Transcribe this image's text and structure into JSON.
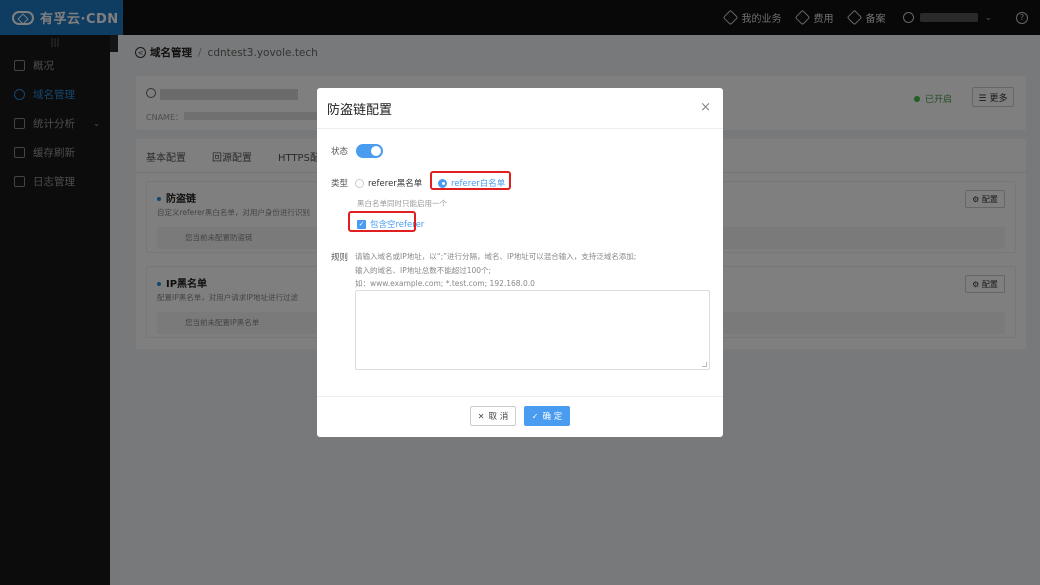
{
  "app": {
    "brand": "有孚云·CDN"
  },
  "topnav": {
    "items": [
      "我的业务",
      "费用",
      "备案"
    ]
  },
  "sidebar": {
    "collapse": "|||",
    "items": [
      {
        "label": "概况",
        "icon": "cube-icon"
      },
      {
        "label": "域名管理",
        "icon": "globe-icon",
        "active": true
      },
      {
        "label": "统计分析",
        "icon": "chart-icon",
        "expandable": true
      },
      {
        "label": "缓存刷新",
        "icon": "refresh-icon"
      },
      {
        "label": "日志管理",
        "icon": "file-icon"
      }
    ]
  },
  "breadcrumb": {
    "main": "域名管理",
    "sep": "/",
    "sub": "cdntest3.yovole.tech"
  },
  "domain_card": {
    "cname_label": "CNAME：",
    "status": "已开启",
    "more": "☰ 更多"
  },
  "tabs": [
    "基本配置",
    "回源配置",
    "HTTPS配置"
  ],
  "sections": [
    {
      "title": "防盗链",
      "desc": "自定义referer黑白名单，对用户身份进行识别",
      "empty": "您当前未配置防盗链",
      "btn": "⚙ 配置"
    },
    {
      "title": "IP黑名单",
      "desc": "配置IP黑名单，对用户请求IP地址进行过滤",
      "empty": "您当前未配置IP黑名单",
      "btn": "⚙ 配置"
    }
  ],
  "modal": {
    "title": "防盗链配置",
    "close": "×",
    "status_label": "状态",
    "type_label": "类型",
    "radio_black": "referer黑名单",
    "radio_white": "referer白名单",
    "type_hint": "黑白名单同时只能启用一个",
    "include_empty": "包含空referer",
    "rule_label": "规则",
    "rule_line1": "请输入域名或IP地址，以“;”进行分隔，域名、IP地址可以混合输入，支持泛域名添加;",
    "rule_line2": "输入的域名、IP地址总数不能超过100个;",
    "rule_line3": "如：www.example.com; *.test.com; 192.168.0.0",
    "textarea_value": "",
    "cancel": "取 消",
    "ok": "确 定"
  },
  "colors": {
    "accent": "#4a9cf0",
    "highlight": "#e02020",
    "brand_bg": "#1f78c2"
  }
}
